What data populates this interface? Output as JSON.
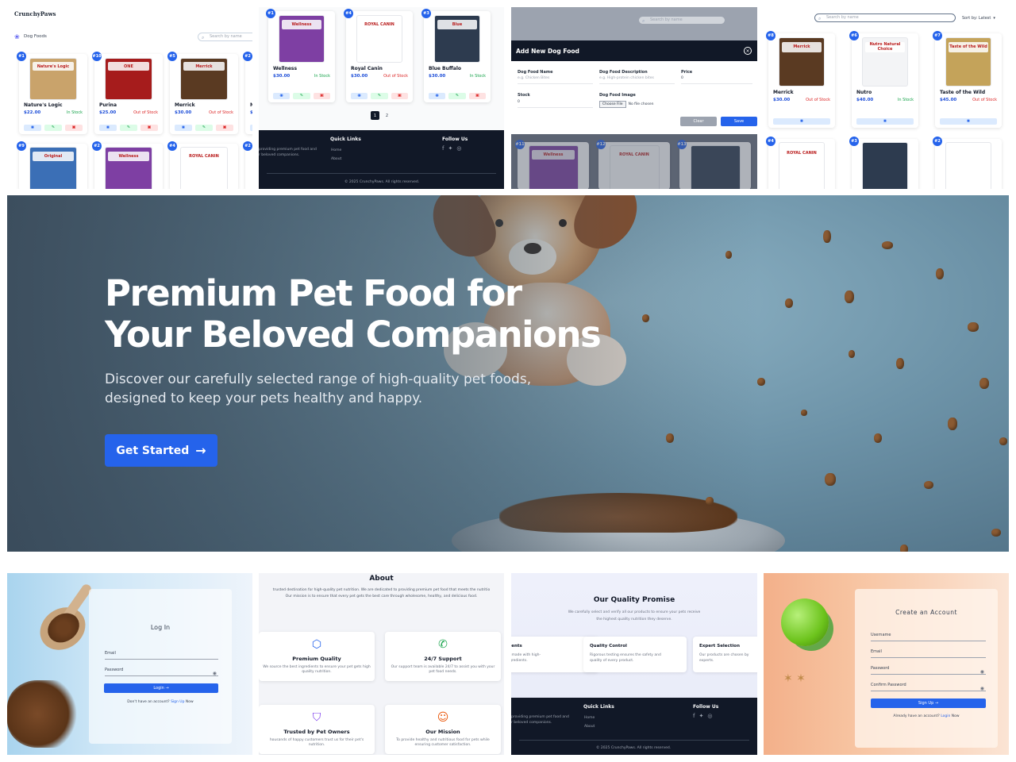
{
  "panel1": {
    "app_title": "CrunchyPaws",
    "section_label": "Dog Foods",
    "search_placeholder": "Search by name",
    "cards_row1": [
      {
        "badge": "#1",
        "name": "Nature's Logic",
        "price": "$22.00",
        "stock": "In Stock",
        "in": true,
        "pkg_color": "#c9a36b",
        "pkg_label": "Nature's Logic"
      },
      {
        "badge": "#10",
        "name": "Purina",
        "price": "$25.00",
        "stock": "Out of Stock",
        "in": false,
        "pkg_color": "#a61c1c",
        "pkg_label": "ONE"
      },
      {
        "badge": "#5",
        "name": "Merrick",
        "price": "$30.00",
        "stock": "Out of Stock",
        "in": false,
        "pkg_color": "#5a3a22",
        "pkg_label": "Merrick"
      },
      {
        "badge": "#2",
        "name": "Nu",
        "price": "$4",
        "stock": "",
        "in": true,
        "pkg_color": "#e5e7eb",
        "pkg_label": ""
      }
    ],
    "cards_row2": [
      {
        "badge": "#9",
        "pkg_color": "#3b6fb6",
        "pkg_label": "Original"
      },
      {
        "badge": "#2",
        "pkg_color": "#7e3fa3",
        "pkg_label": "Wellness"
      },
      {
        "badge": "#4",
        "pkg_color": "#ffffff",
        "pkg_label": "ROYAL CANIN"
      },
      {
        "badge": "#2",
        "pkg_color": "#e5e7eb",
        "pkg_label": ""
      }
    ]
  },
  "panel2": {
    "cards": [
      {
        "badge": "#1",
        "name": "Wellness",
        "price": "$30.00",
        "stock": "In Stock",
        "in": true,
        "pkg_color": "#7e3fa3",
        "pkg_label": "Wellness"
      },
      {
        "badge": "#4",
        "name": "Royal Canin",
        "price": "$30.00",
        "stock": "Out of Stock",
        "in": false,
        "pkg_color": "#ffffff",
        "pkg_label": "ROYAL CANIN"
      },
      {
        "badge": "#3",
        "name": "Blue Buffalo",
        "price": "$30.00",
        "stock": "In Stock",
        "in": true,
        "pkg_color": "#2d3b4f",
        "pkg_label": "Blue"
      }
    ],
    "pages": [
      "1",
      "2"
    ],
    "footer": {
      "quick_links_title": "Quick Links",
      "links": [
        "Home",
        "About"
      ],
      "follow_title": "Follow Us",
      "about_text_1": "providing premium pet food and",
      "about_text_2": "r beloved companions.",
      "copyright": "© 2025 CrunchyPaws. All rights reserved."
    }
  },
  "panel3": {
    "search_placeholder": "Search by name",
    "modal_title": "Add New Dog Food",
    "name_label": "Dog Food Name",
    "name_placeholder": "e.g. Chicken Bites",
    "desc_label": "Dog Food Description",
    "desc_placeholder": "e.g. High-protein chicken bites",
    "price_label": "Price",
    "price_value": "0",
    "stock_label": "Stock",
    "stock_value": "0",
    "image_label": "Dog Food Image",
    "choose_file": "Choose File",
    "no_file": "No file chosen",
    "clear_label": "Clear",
    "save_label": "Save",
    "bottom_cards": [
      {
        "badge": "#11",
        "pkg_color": "#7e3fa3",
        "pkg_label": "Wellness"
      },
      {
        "badge": "#12",
        "pkg_color": "#ffffff",
        "pkg_label": "ROYAL CANIN"
      },
      {
        "badge": "#13",
        "pkg_color": "#2d3b4f",
        "pkg_label": ""
      }
    ]
  },
  "panel4": {
    "search_placeholder": "Search by name",
    "sort_label": "Sort by: Latest",
    "cards": [
      {
        "badge": "#8",
        "name": "Merrick",
        "price": "$30.00",
        "stock": "Out of Stock",
        "in": false,
        "pkg_color": "#5a3a22",
        "pkg_label": "Merrick"
      },
      {
        "badge": "#6",
        "name": "Nutro",
        "price": "$40.00",
        "stock": "In Stock",
        "in": true,
        "pkg_color": "#f3f4f6",
        "pkg_label": "Nutro Natural Choice"
      },
      {
        "badge": "#7",
        "name": "Taste of the Wild",
        "price": "$45.00",
        "stock": "Out of Stock",
        "in": false,
        "pkg_color": "#c4a35a",
        "pkg_label": "Taste of the Wild"
      }
    ],
    "bottom_cards": [
      {
        "badge": "#4",
        "pkg_color": "#ffffff",
        "pkg_label": "ROYAL CANIN"
      },
      {
        "badge": "#3",
        "pkg_color": "#2d3b4f",
        "pkg_label": ""
      },
      {
        "badge": "#2",
        "pkg_color": "#ffffff",
        "pkg_label": ""
      }
    ]
  },
  "hero": {
    "title_line1": "Premium Pet Food for",
    "title_line2": "Your Beloved Companions",
    "subtitle_line1": "Discover our carefully selected range of high-quality pet foods,",
    "subtitle_line2": "designed to keep your pets healthy and happy.",
    "cta_label": "Get Started",
    "cta_icon": "arrow-right-icon"
  },
  "login": {
    "title": "Log In",
    "email_label": "Email",
    "password_label": "Password",
    "button_label": "Login",
    "signup_prompt": "Don't have an account?",
    "signup_link": "Sign Up",
    "signup_suffix": "Now"
  },
  "about": {
    "title": "About",
    "intro_1": "trusted destination for high-quality pet nutrition. We are dedicated to providing premium pet food that meets the nutritio",
    "intro_2": "Our mission is to ensure that every pet gets the best care through wholesome, healthy, and delicious food.",
    "features": [
      {
        "icon": "cube-icon",
        "glyph": "⬡",
        "color": "#2563eb",
        "title": "Premium Quality",
        "desc": "We source the best ingredients to ensure your pet gets high quality nutrition."
      },
      {
        "icon": "phone-icon",
        "glyph": "✆",
        "color": "#16a34a",
        "title": "24/7 Support",
        "desc": "Our support team is available 24/7 to assist you with your pet food needs."
      },
      {
        "icon": "shield-check-icon",
        "glyph": "⛉",
        "color": "#7c3aed",
        "title": "Trusted by Pet Owners",
        "desc": "housands of happy customers trust us for their pet's nutrition."
      },
      {
        "icon": "users-icon",
        "glyph": "☺",
        "color": "#ea580c",
        "title": "Our Mission",
        "desc": "To provide healthy and nutritious food for pets while ensuring customer satisfaction."
      }
    ]
  },
  "quality": {
    "title": "Our Quality Promise",
    "intro_1": "We carefully select and verify all our products to ensure your pets receive",
    "intro_2": "the highest quality nutrition they deserve.",
    "items": [
      {
        "title": "redients",
        "desc": "s are made with high-\nre ingredients."
      },
      {
        "title": "Quality Control",
        "desc": "Rigorous testing ensures the safety and\nquality of every product."
      },
      {
        "title": "Expert Selection",
        "desc": "Our products are chosen by\nexperts."
      }
    ],
    "footer": {
      "about_1": "providing premium pet food and",
      "about_2": "r beloved companions.",
      "quick_links_title": "Quick Links",
      "links": [
        "Home",
        "About"
      ],
      "follow_title": "Follow Us",
      "copyright": "© 2025 CrunchyPaws. All rights reserved."
    }
  },
  "signup": {
    "title": "Create an Account",
    "username_label": "Username",
    "email_label": "Email",
    "password_label": "Password",
    "confirm_label": "Confirm Password",
    "button_label": "Sign Up",
    "login_prompt": "Already have an account?",
    "login_link": "Login",
    "login_suffix": "Now"
  },
  "colors": {
    "accent": "#2563eb",
    "footer_bg": "#111827",
    "in_stock": "#16a34a",
    "out_of_stock": "#dc2626"
  }
}
